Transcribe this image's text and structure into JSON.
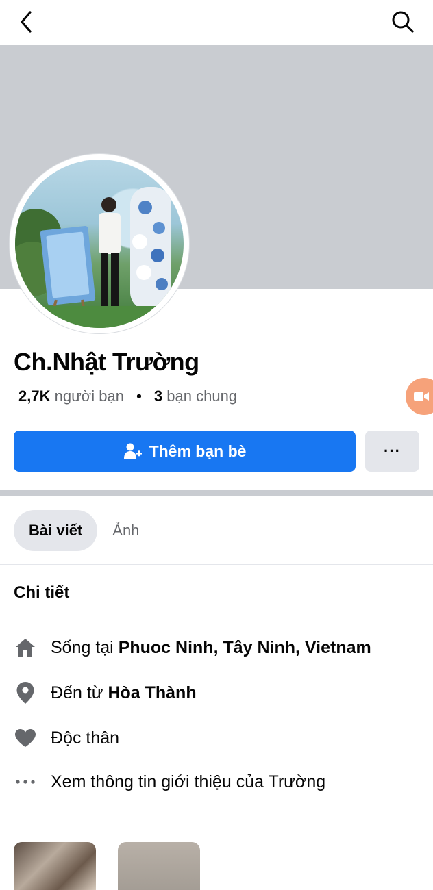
{
  "header": {
    "back_icon": "chevron-left-icon",
    "search_icon": "search-icon"
  },
  "profile": {
    "name": "Ch.Nhật Trường",
    "friends_count": "2,7K",
    "friends_label": "người bạn",
    "mutual_count": "3",
    "mutual_label": "bạn chung",
    "separator": "•"
  },
  "actions": {
    "add_friend_label": "Thêm bạn bè",
    "more_label": "···",
    "add_friend_icon": "person-add-icon"
  },
  "tabs": [
    {
      "label": "Bài viết",
      "active": true
    },
    {
      "label": "Ảnh",
      "active": false
    }
  ],
  "details": {
    "title": "Chi tiết",
    "items": [
      {
        "icon": "home-icon",
        "prefix": "Sống tại ",
        "value": "Phuoc Ninh, Tây Ninh, Vietnam"
      },
      {
        "icon": "location-pin-icon",
        "prefix": "Đến từ ",
        "value": "Hòa Thành"
      },
      {
        "icon": "heart-icon",
        "prefix": "Độc thân",
        "value": ""
      },
      {
        "icon": "more-dots-icon",
        "prefix": "Xem thông tin giới thiệu của Trường",
        "value": ""
      }
    ]
  },
  "colors": {
    "accent": "#1877f2",
    "cover": "#c9ccd1",
    "muted_text": "#65676b"
  }
}
